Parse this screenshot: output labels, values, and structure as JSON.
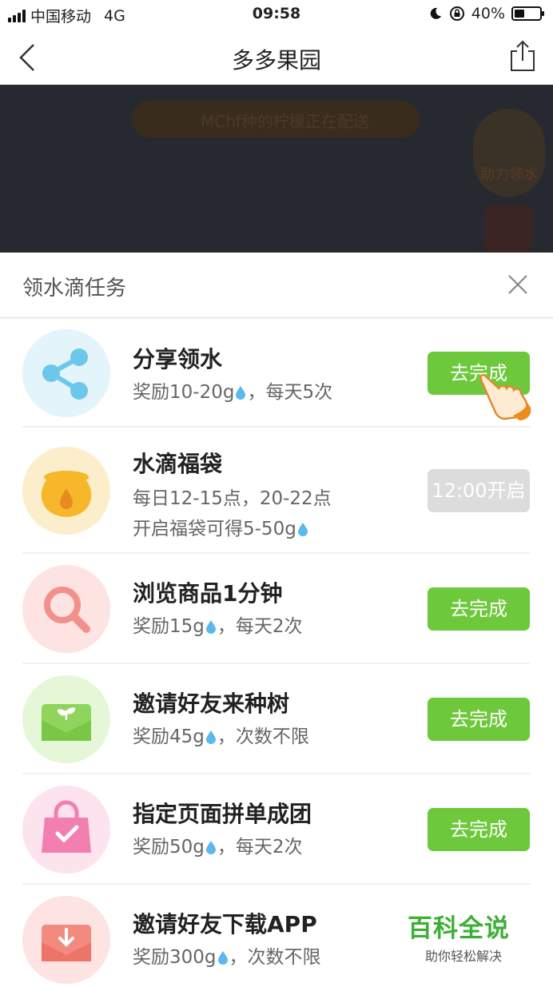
{
  "status_bar": {
    "carrier": "中国移动",
    "network": "4G",
    "time": "09:58",
    "battery": "40%",
    "battery_level": 0.4
  },
  "nav": {
    "title": "多多果园"
  },
  "game": {
    "banner": "MChf种的柠檬正在配送",
    "helper_label": "助力领水"
  },
  "panel": {
    "title": "领水滴任务",
    "tasks": [
      {
        "name": "分享领水",
        "desc1_a": "奖励10-20g",
        "desc1_b": "，每天5次",
        "desc2": "",
        "button": "去完成",
        "enabled": true,
        "icon": "share-icon",
        "bg": "#e3f4fb",
        "fg": "#6cc8ea"
      },
      {
        "name": "水滴福袋",
        "desc1_a": "每日12-15点，20-22点",
        "desc1_b": "",
        "desc2": "开启福袋可得5-50g",
        "button": "12:00开启",
        "enabled": false,
        "icon": "lucky-bag-icon",
        "bg": "#fdeecb",
        "fg": "#f6b72b"
      },
      {
        "name": "浏览商品1分钟",
        "desc1_a": "奖励15g",
        "desc1_b": "，每天2次",
        "desc2": "",
        "button": "去完成",
        "enabled": true,
        "icon": "magnifier-icon",
        "bg": "#fde3e1",
        "fg": "#f2918b"
      },
      {
        "name": "邀请好友来种树",
        "desc1_a": "奖励45g",
        "desc1_b": "，次数不限",
        "desc2": "",
        "button": "去完成",
        "enabled": true,
        "icon": "envelope-sprout-icon",
        "bg": "#e6f7d8",
        "fg": "#8fd45d"
      },
      {
        "name": "指定页面拼单成团",
        "desc1_a": "奖励50g",
        "desc1_b": "，每天2次",
        "desc2": "",
        "button": "去完成",
        "enabled": true,
        "icon": "shopping-bag-icon",
        "bg": "#fde3ee",
        "fg": "#f27fb0"
      },
      {
        "name": "邀请好友下载APP",
        "desc1_a": "奖励300g",
        "desc1_b": "，次数不限",
        "desc2": "",
        "button": "",
        "enabled": true,
        "icon": "download-envelope-icon",
        "bg": "#fde3e1",
        "fg": "#f38a80"
      }
    ]
  },
  "watermark": {
    "title": "百科全说",
    "subtitle": "助你轻松解决"
  },
  "colors": {
    "accent": "#6dc93b",
    "disabled": "#dcdcdc",
    "water": "#5ab8ee"
  }
}
